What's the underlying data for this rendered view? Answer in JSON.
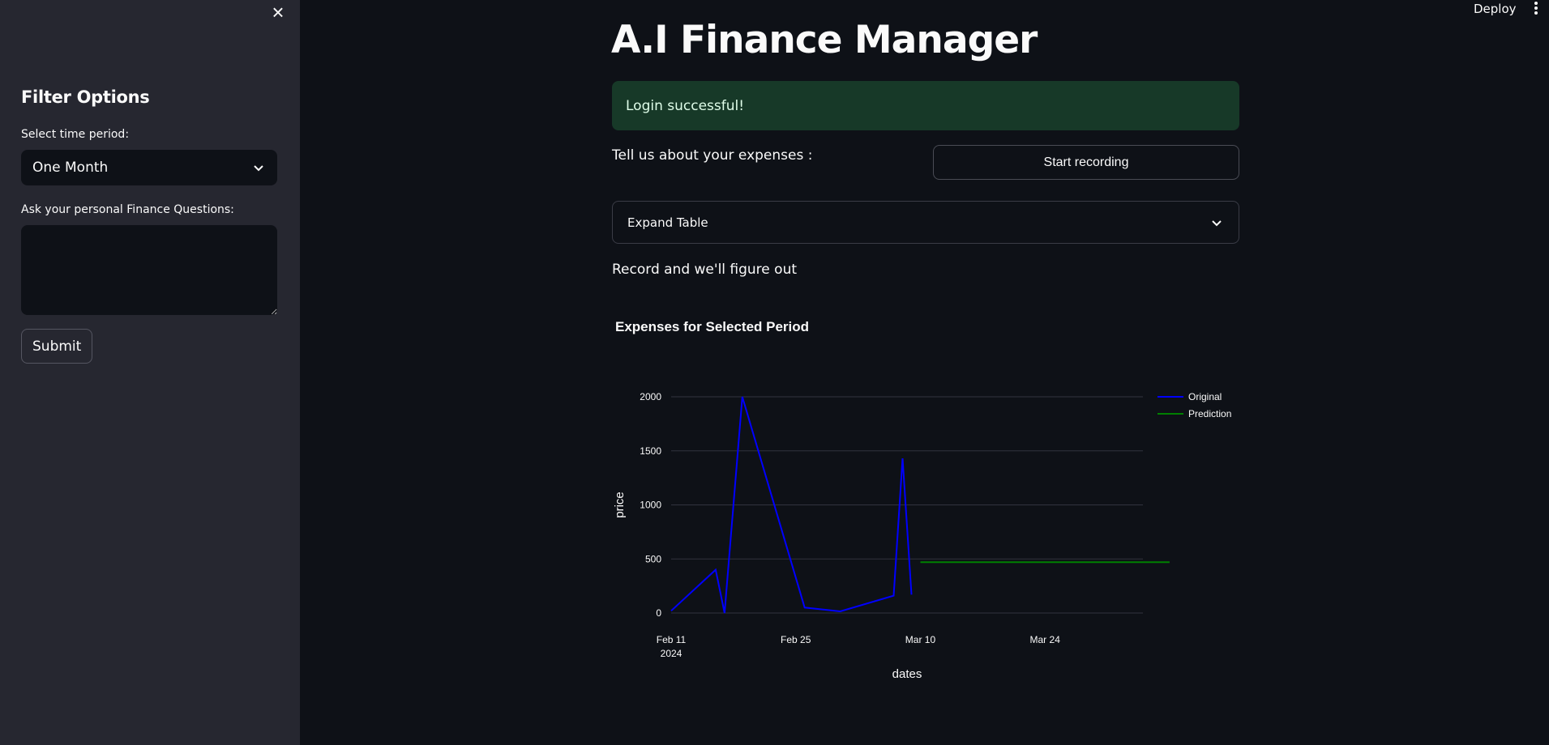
{
  "sidebar": {
    "title": "Filter Options",
    "period_label": "Select time period:",
    "period_value": "One Month",
    "question_label": "Ask your personal Finance Questions:",
    "question_value": "",
    "submit_label": "Submit",
    "close_icon": "close-icon"
  },
  "header": {
    "deploy_label": "Deploy",
    "menu_icon": "kebab-menu-icon"
  },
  "main": {
    "title": "A.I Finance Manager",
    "alert": "Login successful!",
    "expenses_prompt": "Tell us about your expenses :",
    "record_button": "Start recording",
    "expander_label": "Expand Table",
    "record_note": "Record and we'll figure out"
  },
  "colors": {
    "success_bg": "#173928",
    "original_line": "#0000ff",
    "prediction_line": "#008000"
  },
  "chart_data": {
    "type": "line",
    "title": "Expenses for Selected Period",
    "xlabel": "dates",
    "ylabel": "price",
    "ylim": [
      0,
      2000
    ],
    "yticks": [
      0,
      500,
      1000,
      1500,
      2000
    ],
    "xlim": [
      "2024-02-11",
      "2024-04-04"
    ],
    "xticks": [
      {
        "date": "2024-02-11",
        "label": "Feb 11",
        "sublabel": "2024"
      },
      {
        "date": "2024-02-25",
        "label": "Feb 25",
        "sublabel": ""
      },
      {
        "date": "2024-03-10",
        "label": "Mar 10",
        "sublabel": ""
      },
      {
        "date": "2024-03-24",
        "label": "Mar 24",
        "sublabel": ""
      }
    ],
    "legend_position": "top-right",
    "grid": true,
    "series": [
      {
        "name": "Original",
        "color": "#0000ff",
        "points": [
          {
            "x": "2024-02-11",
            "y": 20
          },
          {
            "x": "2024-02-16",
            "y": 400
          },
          {
            "x": "2024-02-17",
            "y": 0
          },
          {
            "x": "2024-02-19",
            "y": 2000
          },
          {
            "x": "2024-02-26",
            "y": 50
          },
          {
            "x": "2024-03-01",
            "y": 15
          },
          {
            "x": "2024-03-07",
            "y": 160
          },
          {
            "x": "2024-03-08",
            "y": 1430
          },
          {
            "x": "2024-03-09",
            "y": 170
          }
        ]
      },
      {
        "name": "Prediction",
        "color": "#008000",
        "points": [
          {
            "x": "2024-03-10",
            "y": 470
          },
          {
            "x": "2024-04-07",
            "y": 470
          }
        ]
      }
    ]
  }
}
